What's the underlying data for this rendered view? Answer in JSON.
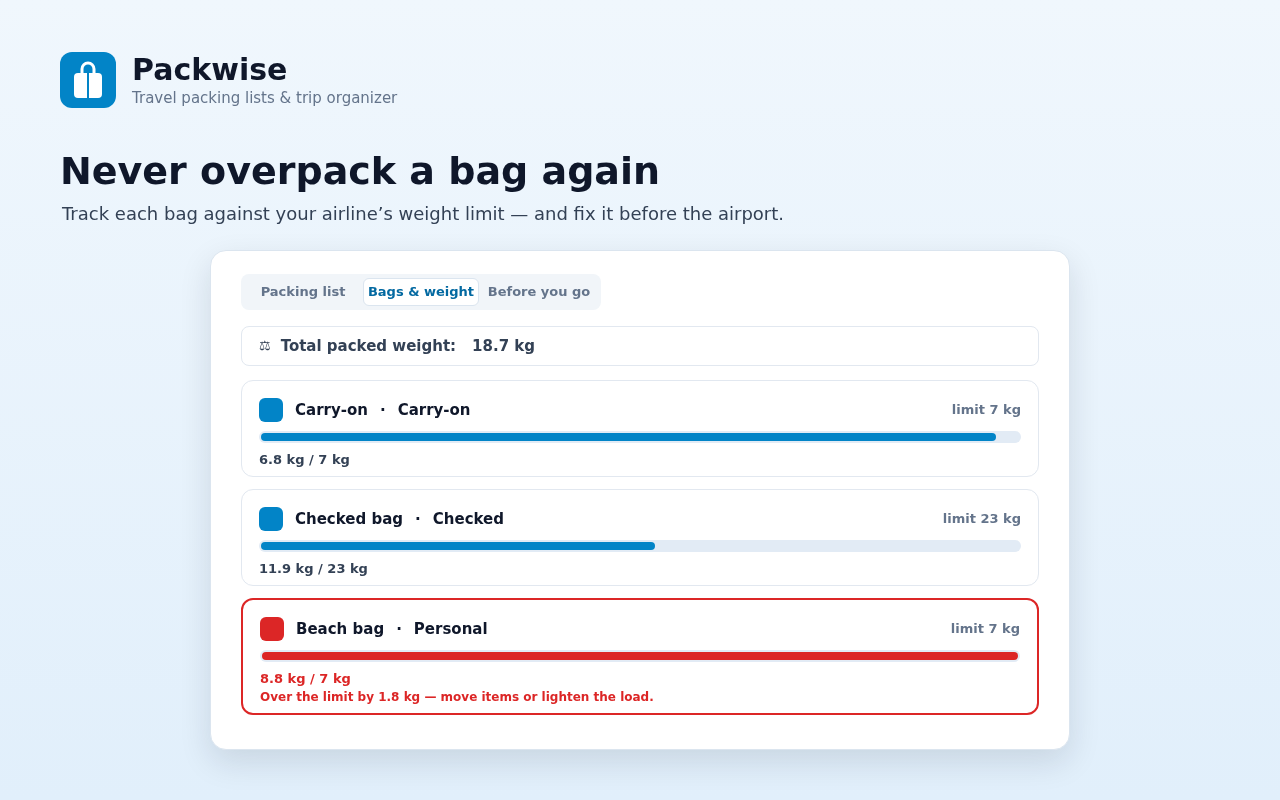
{
  "app": {
    "name": "Packwise",
    "tagline": "Travel packing lists & trip organizer"
  },
  "hero": {
    "title": "Never overpack a bag again",
    "subtitle": "Track each bag against your airline’s weight limit — and fix it before the airport."
  },
  "tabs": [
    {
      "label": "Packing list",
      "selected": false
    },
    {
      "label": "Bags & weight",
      "selected": true
    },
    {
      "label": "Before you go",
      "selected": false
    }
  ],
  "total": {
    "icon": "⚖",
    "label": "Total packed weight:",
    "value": "18.7 kg"
  },
  "bags": [
    {
      "name": "Carry-on",
      "separator": "·",
      "type": "Carry-on",
      "limit": "limit 7 kg",
      "level": 0.97,
      "reading": "6.8 kg / 7 kg",
      "color": "#0284c7",
      "over": false
    },
    {
      "name": "Checked bag",
      "separator": "·",
      "type": "Checked",
      "limit": "limit 23 kg",
      "level": 0.52,
      "reading": "11.9 kg / 23 kg",
      "color": "#0284c7",
      "over": false
    },
    {
      "name": "Beach bag",
      "separator": "·",
      "type": "Personal",
      "limit": "limit 7 kg",
      "level": 1,
      "reading": "8.8 kg / 7 kg",
      "color": "#dc2626",
      "over": true,
      "warning": "Over the limit by 1.8 kg — move items or lighten the load."
    }
  ]
}
